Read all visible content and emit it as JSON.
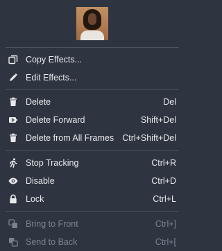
{
  "menu": {
    "group1": [
      {
        "label": "Copy Effects...",
        "icon": "copy-icon"
      },
      {
        "label": "Edit Effects...",
        "icon": "pencil-icon"
      }
    ],
    "group2": [
      {
        "label": "Delete",
        "shortcut": "Del",
        "icon": "trash-icon"
      },
      {
        "label": "Delete Forward",
        "shortcut": "Shift+Del",
        "icon": "delete-forward-icon"
      },
      {
        "label": "Delete from All Frames",
        "shortcut": "Ctrl+Shift+Del",
        "icon": "trash-icon"
      }
    ],
    "group3": [
      {
        "label": "Stop Tracking",
        "shortcut": "Ctrl+R",
        "icon": "running-person-icon"
      },
      {
        "label": "Disable",
        "shortcut": "Ctrl+D",
        "icon": "eye-icon"
      },
      {
        "label": "Lock",
        "shortcut": "Ctrl+L",
        "icon": "lock-icon"
      }
    ],
    "group4": [
      {
        "label": "Bring to Front",
        "shortcut": "Ctrl+]",
        "icon": "bring-to-front-icon",
        "disabled": true
      },
      {
        "label": "Send to Back",
        "shortcut": "Ctrl+[",
        "icon": "send-to-back-icon",
        "disabled": true
      }
    ]
  },
  "colors": {
    "background": "#2e3541",
    "text": "#e8eaed",
    "disabled_text": "#7b8390",
    "separator": "#4b5360"
  }
}
